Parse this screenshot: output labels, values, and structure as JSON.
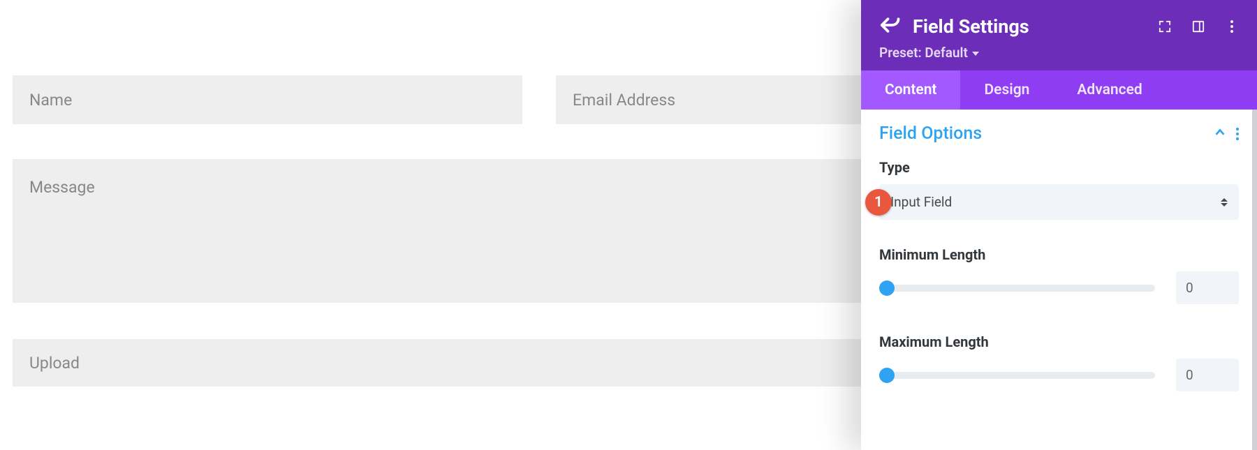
{
  "form": {
    "name_placeholder": "Name",
    "email_placeholder": "Email Address",
    "message_placeholder": "Message",
    "upload_placeholder": "Upload"
  },
  "panel": {
    "title": "Field Settings",
    "preset_label": "Preset: Default",
    "tabs": {
      "content": "Content",
      "design": "Design",
      "advanced": "Advanced"
    },
    "section_title": "Field Options",
    "type_label": "Type",
    "type_value": "Input Field",
    "min_length_label": "Minimum Length",
    "min_length_value": "0",
    "max_length_label": "Maximum Length",
    "max_length_value": "0",
    "annotation_badge": "1"
  }
}
